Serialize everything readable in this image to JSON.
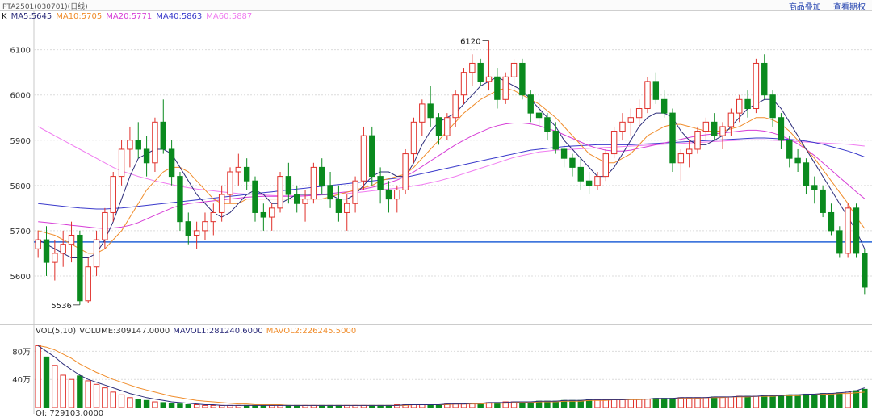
{
  "header": {
    "title": "PTA2501(030701)(日线)",
    "link_overlay": "商品叠加",
    "link_contract": "查看期权"
  },
  "legend": [
    {
      "text": "K",
      "color": "#222222"
    },
    {
      "text": "MA5:5645",
      "color": "#2c2c7a"
    },
    {
      "text": "MA10:5705",
      "color": "#f08c2a"
    },
    {
      "text": "MA20:5771",
      "color": "#d63cd6"
    },
    {
      "text": "MA40:5863",
      "color": "#3a3acb"
    },
    {
      "text": "MA60:5887",
      "color": "#f07cf0"
    }
  ],
  "vol_legend": [
    {
      "text": "VOL(5,10)",
      "color": "#333333"
    },
    {
      "text": "VOLUME:309147.0000",
      "color": "#333333"
    },
    {
      "text": "MAVOL1:281240.6000",
      "color": "#2c2c7a"
    },
    {
      "text": "MAVOL2:226245.5000",
      "color": "#f08c2a"
    }
  ],
  "extra_line": "OI: 729103.0000",
  "chart_data": {
    "type": "candlestick",
    "price_axis": {
      "ticks": [
        5600,
        5700,
        5800,
        5900,
        6000,
        6100
      ],
      "range": [
        5500,
        6160
      ]
    },
    "volume_axis": {
      "ticks": [
        40,
        80
      ],
      "tick_labels": [
        "40万",
        "80万"
      ],
      "unit": "万",
      "range": [
        0,
        100
      ]
    },
    "annotations": [
      {
        "label": "6120",
        "value": 6120,
        "index": 54
      },
      {
        "label": "5536",
        "value": 5536,
        "index": 5
      }
    ],
    "hline": {
      "value": 5675,
      "color": "#2563d8"
    },
    "candles": [
      [
        5660,
        5700,
        5640,
        5680
      ],
      [
        5680,
        5710,
        5600,
        5630
      ],
      [
        5630,
        5680,
        5590,
        5650
      ],
      [
        5650,
        5700,
        5620,
        5670
      ],
      [
        5670,
        5720,
        5630,
        5690
      ],
      [
        5690,
        5700,
        5536,
        5545
      ],
      [
        5545,
        5640,
        5540,
        5620
      ],
      [
        5620,
        5700,
        5600,
        5680
      ],
      [
        5680,
        5750,
        5660,
        5740
      ],
      [
        5740,
        5830,
        5720,
        5820
      ],
      [
        5820,
        5900,
        5800,
        5880
      ],
      [
        5880,
        5930,
        5840,
        5900
      ],
      [
        5900,
        5940,
        5860,
        5880
      ],
      [
        5880,
        5910,
        5820,
        5850
      ],
      [
        5850,
        5950,
        5830,
        5940
      ],
      [
        5940,
        5990,
        5870,
        5880
      ],
      [
        5880,
        5900,
        5800,
        5820
      ],
      [
        5820,
        5830,
        5700,
        5720
      ],
      [
        5720,
        5740,
        5670,
        5690
      ],
      [
        5690,
        5720,
        5660,
        5700
      ],
      [
        5700,
        5740,
        5680,
        5720
      ],
      [
        5720,
        5760,
        5690,
        5740
      ],
      [
        5740,
        5800,
        5720,
        5780
      ],
      [
        5780,
        5840,
        5760,
        5830
      ],
      [
        5830,
        5870,
        5800,
        5840
      ],
      [
        5840,
        5860,
        5790,
        5810
      ],
      [
        5810,
        5820,
        5720,
        5740
      ],
      [
        5740,
        5760,
        5700,
        5730
      ],
      [
        5730,
        5760,
        5700,
        5750
      ],
      [
        5750,
        5830,
        5740,
        5820
      ],
      [
        5820,
        5850,
        5760,
        5780
      ],
      [
        5780,
        5800,
        5740,
        5760
      ],
      [
        5760,
        5790,
        5720,
        5770
      ],
      [
        5770,
        5850,
        5760,
        5840
      ],
      [
        5840,
        5860,
        5780,
        5800
      ],
      [
        5800,
        5830,
        5750,
        5770
      ],
      [
        5770,
        5800,
        5720,
        5740
      ],
      [
        5740,
        5780,
        5700,
        5760
      ],
      [
        5760,
        5820,
        5740,
        5810
      ],
      [
        5810,
        5930,
        5790,
        5910
      ],
      [
        5910,
        5930,
        5800,
        5820
      ],
      [
        5820,
        5840,
        5760,
        5790
      ],
      [
        5790,
        5810,
        5740,
        5770
      ],
      [
        5770,
        5800,
        5740,
        5790
      ],
      [
        5790,
        5880,
        5780,
        5870
      ],
      [
        5870,
        5950,
        5850,
        5940
      ],
      [
        5940,
        5990,
        5910,
        5980
      ],
      [
        5980,
        6020,
        5930,
        5950
      ],
      [
        5950,
        5960,
        5890,
        5910
      ],
      [
        5910,
        5960,
        5900,
        5950
      ],
      [
        5950,
        6010,
        5930,
        6000
      ],
      [
        6000,
        6060,
        5980,
        6050
      ],
      [
        6050,
        6090,
        6020,
        6070
      ],
      [
        6070,
        6080,
        6020,
        6030
      ],
      [
        6030,
        6120,
        6010,
        6040
      ],
      [
        6040,
        6060,
        5970,
        5990
      ],
      [
        5990,
        6050,
        5980,
        6040
      ],
      [
        6040,
        6080,
        6010,
        6070
      ],
      [
        6070,
        6080,
        5990,
        6000
      ],
      [
        6000,
        6010,
        5940,
        5960
      ],
      [
        5960,
        5990,
        5930,
        5950
      ],
      [
        5950,
        5960,
        5900,
        5920
      ],
      [
        5920,
        5940,
        5870,
        5880
      ],
      [
        5880,
        5890,
        5840,
        5860
      ],
      [
        5860,
        5870,
        5820,
        5840
      ],
      [
        5840,
        5860,
        5790,
        5810
      ],
      [
        5810,
        5830,
        5780,
        5800
      ],
      [
        5800,
        5830,
        5790,
        5820
      ],
      [
        5820,
        5880,
        5810,
        5870
      ],
      [
        5870,
        5930,
        5860,
        5920
      ],
      [
        5920,
        5960,
        5900,
        5940
      ],
      [
        5940,
        5970,
        5910,
        5950
      ],
      [
        5950,
        5990,
        5930,
        5970
      ],
      [
        5970,
        6040,
        5960,
        6030
      ],
      [
        6030,
        6050,
        5980,
        5990
      ],
      [
        5990,
        6010,
        5950,
        5960
      ],
      [
        5960,
        5970,
        5830,
        5850
      ],
      [
        5850,
        5880,
        5810,
        5870
      ],
      [
        5870,
        5900,
        5840,
        5880
      ],
      [
        5880,
        5930,
        5870,
        5920
      ],
      [
        5920,
        5950,
        5900,
        5940
      ],
      [
        5940,
        5960,
        5900,
        5910
      ],
      [
        5910,
        5940,
        5880,
        5930
      ],
      [
        5930,
        5970,
        5910,
        5960
      ],
      [
        5960,
        6000,
        5940,
        5990
      ],
      [
        5990,
        6010,
        5950,
        5970
      ],
      [
        5970,
        6080,
        5960,
        6070
      ],
      [
        6070,
        6090,
        5990,
        6000
      ],
      [
        6000,
        6010,
        5930,
        5950
      ],
      [
        5950,
        5960,
        5880,
        5900
      ],
      [
        5900,
        5910,
        5840,
        5860
      ],
      [
        5860,
        5880,
        5830,
        5850
      ],
      [
        5850,
        5860,
        5780,
        5800
      ],
      [
        5800,
        5820,
        5760,
        5790
      ],
      [
        5790,
        5800,
        5730,
        5740
      ],
      [
        5740,
        5760,
        5690,
        5700
      ],
      [
        5700,
        5710,
        5640,
        5650
      ],
      [
        5650,
        5760,
        5640,
        5750
      ],
      [
        5750,
        5760,
        5640,
        5650
      ],
      [
        5650,
        5660,
        5560,
        5575
      ]
    ],
    "volume": [
      88,
      72,
      60,
      46,
      40,
      45,
      38,
      33,
      28,
      22,
      18,
      14,
      12,
      10,
      8,
      7,
      6,
      5,
      4,
      4,
      3,
      3,
      3,
      3,
      3,
      3,
      3,
      3,
      3,
      3,
      3,
      3,
      3,
      3,
      3,
      3,
      3,
      3,
      3,
      3,
      3,
      3,
      3,
      4,
      4,
      4,
      4,
      4,
      4,
      5,
      5,
      5,
      6,
      6,
      7,
      7,
      8,
      8,
      8,
      8,
      9,
      9,
      9,
      10,
      10,
      10,
      11,
      11,
      11,
      11,
      11,
      12,
      12,
      12,
      13,
      13,
      13,
      14,
      14,
      14,
      14,
      15,
      15,
      15,
      16,
      16,
      16,
      17,
      17,
      17,
      18,
      18,
      19,
      19,
      20,
      20,
      21,
      22,
      24,
      26
    ],
    "ma5": [
      5680,
      5670,
      5660,
      5650,
      5640,
      5640,
      5640,
      5650,
      5680,
      5720,
      5770,
      5820,
      5860,
      5870,
      5880,
      5880,
      5870,
      5840,
      5810,
      5780,
      5760,
      5740,
      5730,
      5740,
      5760,
      5780,
      5790,
      5780,
      5760,
      5760,
      5770,
      5780,
      5780,
      5780,
      5780,
      5780,
      5770,
      5770,
      5780,
      5800,
      5820,
      5830,
      5830,
      5820,
      5820,
      5850,
      5890,
      5920,
      5940,
      5950,
      5960,
      5980,
      6000,
      6020,
      6030,
      6040,
      6030,
      6020,
      6010,
      5990,
      5970,
      5950,
      5930,
      5900,
      5880,
      5860,
      5840,
      5820,
      5820,
      5840,
      5870,
      5900,
      5930,
      5950,
      5960,
      5960,
      5950,
      5920,
      5900,
      5890,
      5890,
      5900,
      5910,
      5930,
      5950,
      5970,
      5980,
      5990,
      5990,
      5970,
      5940,
      5910,
      5880,
      5850,
      5820,
      5790,
      5760,
      5730,
      5700,
      5660
    ],
    "ma10": [
      5700,
      5695,
      5690,
      5680,
      5670,
      5660,
      5650,
      5650,
      5660,
      5680,
      5700,
      5730,
      5760,
      5790,
      5810,
      5830,
      5840,
      5840,
      5830,
      5810,
      5790,
      5770,
      5760,
      5760,
      5760,
      5770,
      5770,
      5770,
      5770,
      5770,
      5770,
      5770,
      5770,
      5770,
      5770,
      5775,
      5780,
      5785,
      5790,
      5795,
      5800,
      5810,
      5815,
      5820,
      5825,
      5840,
      5860,
      5880,
      5900,
      5920,
      5940,
      5960,
      5975,
      5990,
      6000,
      6010,
      6015,
      6010,
      6000,
      5990,
      5980,
      5965,
      5950,
      5930,
      5910,
      5890,
      5870,
      5860,
      5850,
      5850,
      5860,
      5870,
      5890,
      5910,
      5920,
      5930,
      5935,
      5935,
      5930,
      5925,
      5920,
      5920,
      5920,
      5925,
      5930,
      5940,
      5950,
      5950,
      5945,
      5935,
      5920,
      5900,
      5880,
      5860,
      5835,
      5810,
      5785,
      5760,
      5730,
      5705
    ],
    "ma20": [
      5720,
      5718,
      5716,
      5714,
      5712,
      5710,
      5708,
      5706,
      5705,
      5706,
      5708,
      5712,
      5718,
      5726,
      5734,
      5742,
      5750,
      5756,
      5760,
      5762,
      5764,
      5766,
      5768,
      5770,
      5772,
      5774,
      5775,
      5776,
      5776,
      5776,
      5776,
      5776,
      5777,
      5778,
      5780,
      5782,
      5784,
      5786,
      5788,
      5792,
      5796,
      5800,
      5806,
      5812,
      5820,
      5830,
      5842,
      5854,
      5866,
      5878,
      5890,
      5900,
      5910,
      5918,
      5926,
      5932,
      5936,
      5938,
      5938,
      5936,
      5932,
      5926,
      5920,
      5912,
      5904,
      5896,
      5888,
      5882,
      5878,
      5876,
      5876,
      5878,
      5882,
      5886,
      5890,
      5894,
      5898,
      5902,
      5906,
      5910,
      5912,
      5914,
      5916,
      5918,
      5920,
      5922,
      5922,
      5920,
      5916,
      5910,
      5902,
      5892,
      5880,
      5866,
      5850,
      5834,
      5818,
      5802,
      5786,
      5771
    ],
    "ma40": [
      5760,
      5758,
      5756,
      5754,
      5752,
      5750,
      5749,
      5748,
      5748,
      5749,
      5750,
      5752,
      5754,
      5756,
      5758,
      5760,
      5762,
      5764,
      5766,
      5768,
      5770,
      5772,
      5774,
      5776,
      5778,
      5780,
      5782,
      5784,
      5786,
      5788,
      5790,
      5792,
      5794,
      5796,
      5798,
      5800,
      5802,
      5804,
      5806,
      5808,
      5810,
      5812,
      5814,
      5816,
      5818,
      5822,
      5826,
      5830,
      5834,
      5838,
      5842,
      5846,
      5850,
      5854,
      5858,
      5862,
      5866,
      5870,
      5874,
      5878,
      5880,
      5882,
      5884,
      5886,
      5887,
      5888,
      5889,
      5890,
      5890,
      5890,
      5890,
      5890,
      5891,
      5892,
      5893,
      5894,
      5895,
      5896,
      5897,
      5898,
      5899,
      5900,
      5901,
      5902,
      5903,
      5904,
      5905,
      5905,
      5904,
      5903,
      5902,
      5900,
      5898,
      5895,
      5891,
      5886,
      5881,
      5876,
      5870,
      5863
    ],
    "ma60": [
      5930,
      5920,
      5910,
      5900,
      5890,
      5880,
      5870,
      5860,
      5850,
      5840,
      5832,
      5826,
      5820,
      5815,
      5810,
      5806,
      5802,
      5798,
      5795,
      5792,
      5790,
      5788,
      5786,
      5784,
      5782,
      5781,
      5780,
      5779,
      5778,
      5777,
      5777,
      5777,
      5777,
      5778,
      5779,
      5780,
      5781,
      5782,
      5784,
      5786,
      5788,
      5790,
      5792,
      5794,
      5796,
      5799,
      5802,
      5806,
      5810,
      5815,
      5820,
      5826,
      5832,
      5838,
      5844,
      5850,
      5856,
      5862,
      5866,
      5870,
      5874,
      5876,
      5878,
      5879,
      5880,
      5881,
      5882,
      5883,
      5884,
      5885,
      5886,
      5887,
      5888,
      5889,
      5890,
      5891,
      5892,
      5893,
      5894,
      5895,
      5896,
      5897,
      5898,
      5899,
      5900,
      5901,
      5901,
      5901,
      5900,
      5899,
      5898,
      5897,
      5896,
      5895,
      5894,
      5893,
      5892,
      5891,
      5889,
      5887
    ],
    "mavol1": [
      88,
      80,
      72,
      62,
      54,
      46,
      40,
      36,
      32,
      28,
      24,
      20,
      17,
      14,
      12,
      10,
      8,
      7,
      6,
      5,
      4,
      4,
      3,
      3,
      3,
      3,
      3,
      3,
      3,
      3,
      3,
      3,
      3,
      3,
      3,
      3,
      3,
      3,
      3,
      3,
      3,
      3,
      3,
      3,
      4,
      4,
      4,
      4,
      4,
      5,
      5,
      5,
      6,
      6,
      7,
      7,
      7,
      8,
      8,
      8,
      9,
      9,
      9,
      10,
      10,
      10,
      11,
      11,
      11,
      11,
      11,
      12,
      12,
      12,
      13,
      13,
      13,
      14,
      14,
      14,
      14,
      15,
      15,
      15,
      16,
      16,
      16,
      17,
      17,
      17,
      18,
      18,
      19,
      19,
      20,
      20,
      21,
      22,
      24,
      28
    ],
    "mavol2": [
      88,
      86,
      82,
      76,
      70,
      62,
      56,
      50,
      45,
      40,
      36,
      32,
      28,
      25,
      22,
      19,
      16,
      14,
      12,
      10,
      9,
      8,
      7,
      6,
      5,
      5,
      4,
      4,
      4,
      4,
      3,
      3,
      3,
      3,
      3,
      3,
      3,
      3,
      3,
      3,
      3,
      3,
      3,
      3,
      3,
      4,
      4,
      4,
      4,
      4,
      5,
      5,
      5,
      5,
      6,
      6,
      6,
      7,
      7,
      7,
      8,
      8,
      8,
      9,
      9,
      9,
      10,
      10,
      10,
      11,
      11,
      11,
      11,
      12,
      12,
      12,
      13,
      13,
      13,
      13,
      14,
      14,
      14,
      15,
      15,
      15,
      16,
      16,
      16,
      17,
      17,
      17,
      18,
      18,
      19,
      19,
      20,
      20,
      21,
      22
    ]
  }
}
